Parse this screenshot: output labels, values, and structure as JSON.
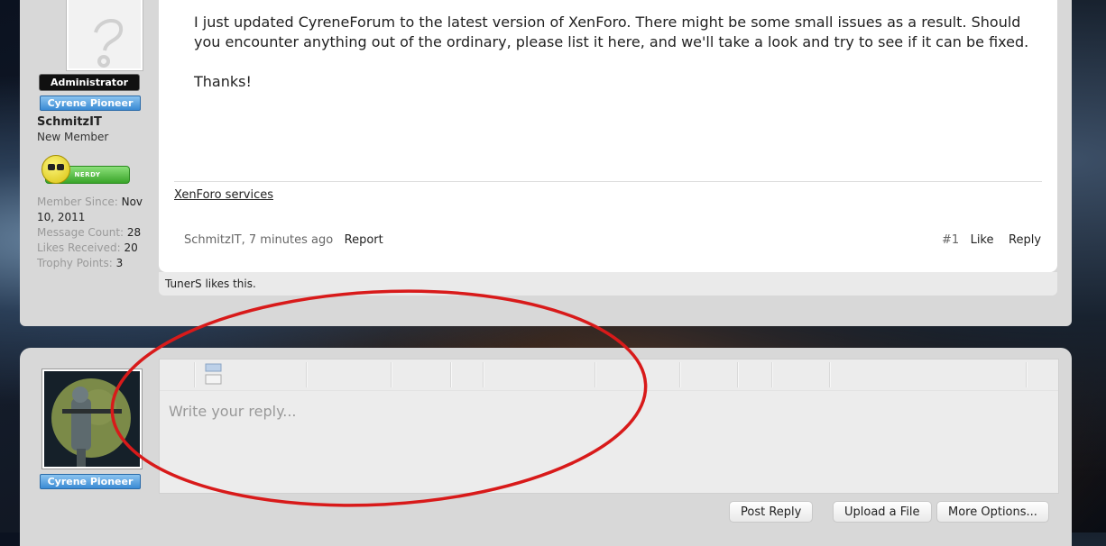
{
  "first_post": {
    "user": {
      "admin_badge": "Administrator",
      "pioneer_badge": "Cyrene Pioneer",
      "username": "SchmitzIT",
      "user_title": "New Member",
      "rank_bar_text": "NERDY",
      "stats": [
        {
          "label": "Member Since:",
          "value": "Nov 10, 2011"
        },
        {
          "label": "Message Count:",
          "value": "28"
        },
        {
          "label": "Likes Received:",
          "value": "20"
        },
        {
          "label": "Trophy Points:",
          "value": "3"
        }
      ]
    },
    "message": {
      "paragraph": "I just updated CyreneForum to the latest version of XenForo. There might be some small issues as a result. Should you encounter anything out of the ordinary, please list it here, and we'll take a look and try to see if it can be fixed.",
      "closing": "Thanks!",
      "signature_link": "XenForo services"
    },
    "meta": {
      "author_time": "SchmitzIT, 7 minutes ago",
      "report": "Report",
      "post_number": "#1",
      "like": "Like",
      "reply": "Reply"
    },
    "likes_summary": "TunerS likes this."
  },
  "reply_form": {
    "pioneer_badge": "Cyrene Pioneer",
    "placeholder": "Write your reply...",
    "buttons": {
      "post_reply": "Post Reply",
      "upload_file": "Upload a File",
      "more_options": "More Options..."
    }
  },
  "colors": {
    "annotation_ellipse": "#d81a1a",
    "pioneer_badge": "#3a8ad4",
    "admin_badge": "#101010"
  },
  "icons": [
    "blank-avatar-icon",
    "nerdy-smiley-icon",
    "soldier-avatar-image",
    "image-toolbar-icon"
  ]
}
